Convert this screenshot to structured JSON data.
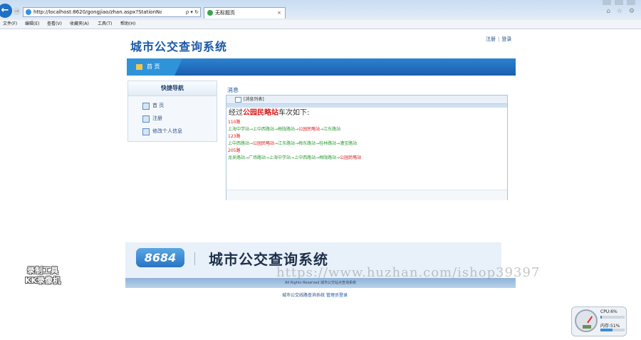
{
  "browser": {
    "url": "http://localhost:8620/gongjiao/zhan.aspx?StationName=",
    "address_tools": "ρ ▾ ↻",
    "tab_title": "无标题页",
    "tab_close": "×",
    "right_icons": "⌂ ☆ ⚙",
    "menu": [
      "文件(F)",
      "编辑(E)",
      "查看(V)",
      "收藏夹(A)",
      "工具(T)",
      "帮助(H)"
    ]
  },
  "header": {
    "site_title": "城市公交查询系统",
    "link_register": "注册",
    "link_login": "登录"
  },
  "nav": {
    "home": "首 页"
  },
  "quick_nav": {
    "title": "快捷导航",
    "items": [
      "首 页",
      "注册",
      "修改个人信息"
    ]
  },
  "messages": {
    "section_title": "消息",
    "table_caption": "[消息列表]",
    "heading_prefix": "经过",
    "station": "公园民略站",
    "heading_suffix": "车次如下:",
    "routes": [
      {
        "bus": "110路",
        "path": "上海中学站→上中西路站→梅陇路站→公园民略站→江东路站"
      },
      {
        "bus": "123路",
        "path": "上中西路站→公园民略站→江东路站→梅东路站→桂林路站→漕宝路站"
      },
      {
        "bus": "205路",
        "path": "龙吴路站→广场路站→上海中学站→上中西路站→梅陇路站→公园民略站"
      }
    ]
  },
  "footer": {
    "logo": "8684",
    "title": "城市公交查询系统",
    "copyright": "All Rights Reserved 城市公交站点查询系统",
    "admin_text": "城市公交线路查询系统",
    "admin_link": "管理员登录"
  },
  "overlay": {
    "recorder_line1": "录制工具",
    "recorder_line2": "KK录像机",
    "watermark": "https://www.huzhan.com/ishop39397",
    "gauge_cpu": "CPU:6%",
    "gauge_mem": "内存:51%",
    "cpu_level": 0.06,
    "mem_level": 0.51
  }
}
